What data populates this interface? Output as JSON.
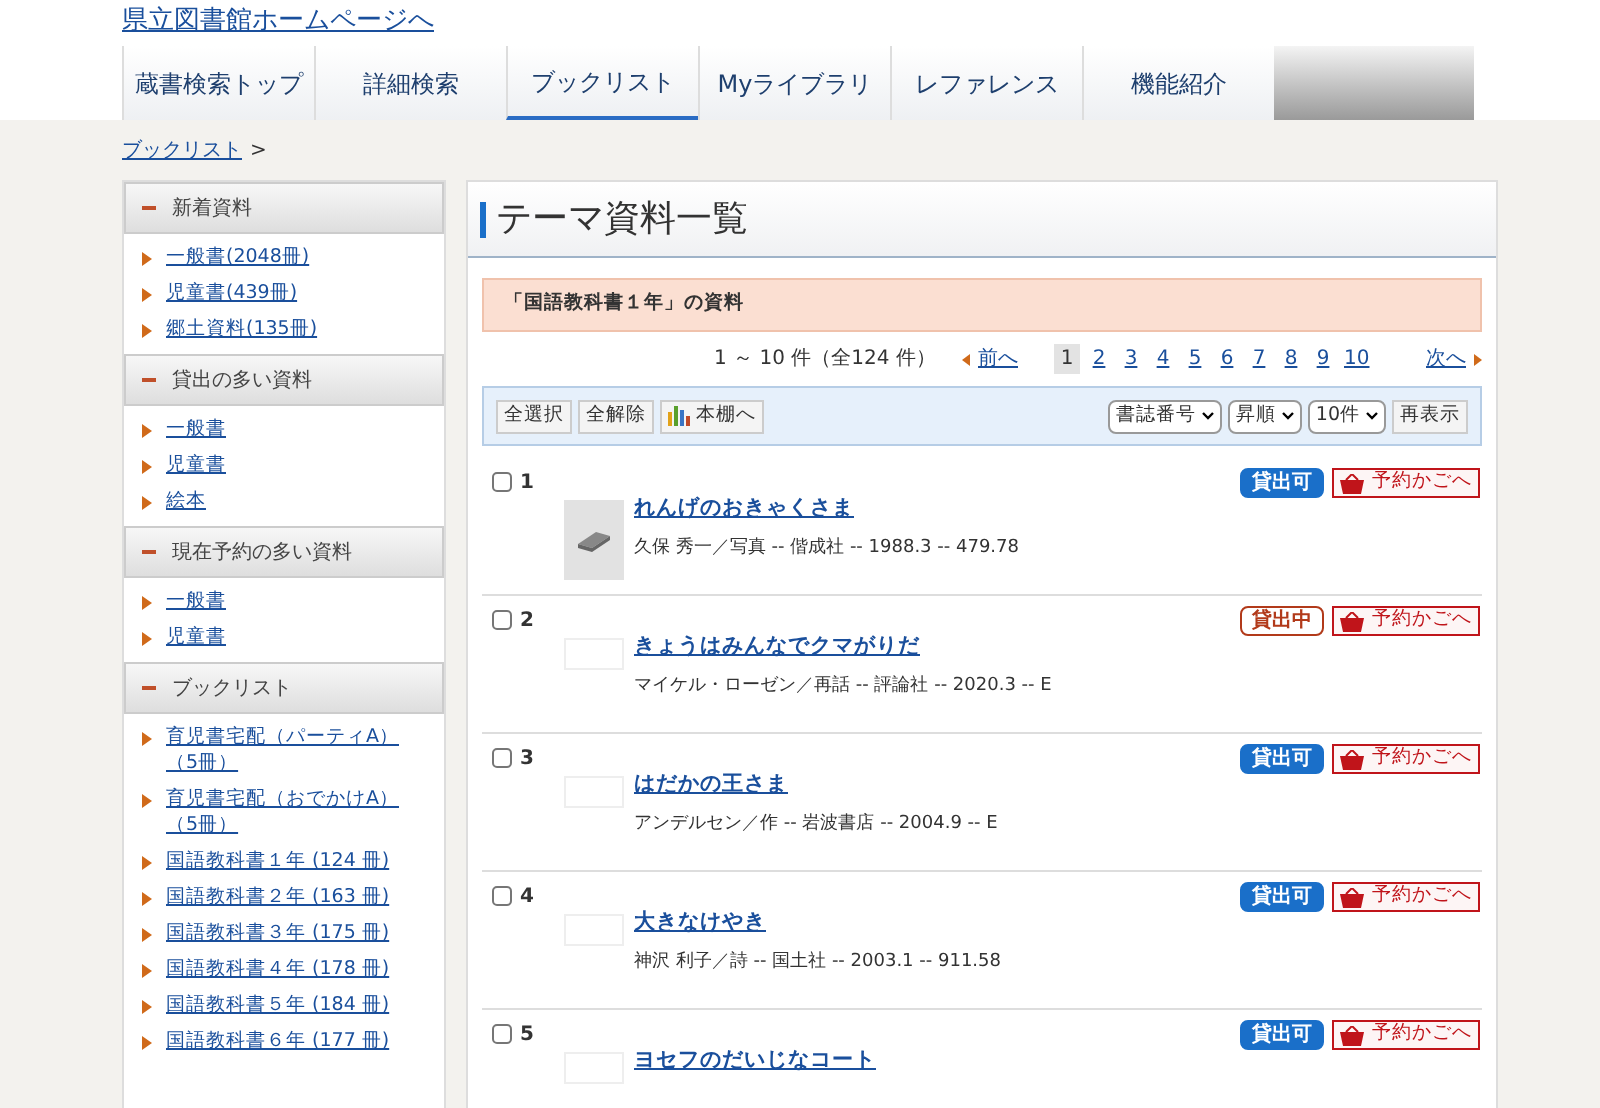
{
  "header": {
    "home_link": "県立図書館ホームページへ"
  },
  "tabs": [
    {
      "label": "蔵書検索トップ",
      "selected": false
    },
    {
      "label": "詳細検索",
      "selected": false
    },
    {
      "label": "ブックリスト",
      "selected": true
    },
    {
      "label": "Myライブラリ",
      "selected": false
    },
    {
      "label": "レファレンス",
      "selected": false
    },
    {
      "label": "機能紹介",
      "selected": false
    }
  ],
  "breadcrumb": {
    "link": "ブックリスト",
    "separator": ">"
  },
  "sidebar": {
    "sections": [
      {
        "title": "新着資料",
        "items": [
          "一般書(2048冊)",
          "児童書(439冊)",
          "郷土資料(135冊)"
        ]
      },
      {
        "title": "貸出の多い資料",
        "items": [
          "一般書",
          "児童書",
          "絵本"
        ]
      },
      {
        "title": "現在予約の多い資料",
        "items": [
          "一般書",
          "児童書"
        ]
      },
      {
        "title": "ブックリスト",
        "items": [
          "育児書宅配（パーティA）（5冊）",
          "育児書宅配（おでかけA）（5冊）",
          "国語教科書１年 (124 冊)",
          "国語教科書２年 (163 冊)",
          "国語教科書３年 (175 冊)",
          "国語教科書４年 (178 冊)",
          "国語教科書５年 (184 冊)",
          "国語教科書６年 (177 冊)"
        ]
      }
    ]
  },
  "main": {
    "title": "テーマ資料一覧",
    "notice": "「国語教科書１年」の資料",
    "pager": {
      "range": "1 ～ 10 件（全124 件）",
      "prev": "前へ",
      "next": "次へ",
      "pages": [
        {
          "label": "1",
          "selected": true
        },
        {
          "label": "2",
          "selected": false
        },
        {
          "label": "3",
          "selected": false
        },
        {
          "label": "4",
          "selected": false
        },
        {
          "label": "5",
          "selected": false
        },
        {
          "label": "6",
          "selected": false
        },
        {
          "label": "7",
          "selected": false
        },
        {
          "label": "8",
          "selected": false
        },
        {
          "label": "9",
          "selected": false
        },
        {
          "label": "10",
          "selected": false
        }
      ]
    },
    "toolbar": {
      "select_all": "全選択",
      "deselect_all": "全解除",
      "shelf": "本棚へ",
      "sort_field": "書誌番号",
      "sort_order": "昇順",
      "per_page": "10件",
      "refresh": "再表示"
    },
    "results": [
      {
        "number": "1",
        "checked": false,
        "has_cover": true,
        "title": "れんげのおきゃくさま",
        "meta": "久保 秀一／写真 -- 偕成社 -- 1988.3 -- 479.78",
        "status": {
          "label": "貸出可",
          "kind": "available"
        },
        "reserve": "予約かごへ"
      },
      {
        "number": "2",
        "checked": false,
        "has_cover": false,
        "title": "きょうはみんなでクマがりだ",
        "meta": "マイケル・ローゼン／再話 -- 評論社 -- 2020.3 -- E",
        "status": {
          "label": "貸出中",
          "kind": "on_loan"
        },
        "reserve": "予約かごへ"
      },
      {
        "number": "3",
        "checked": false,
        "has_cover": false,
        "title": "はだかの王さま",
        "meta": "アンデルセン／作 -- 岩波書店 -- 2004.9 -- E",
        "status": {
          "label": "貸出可",
          "kind": "available"
        },
        "reserve": "予約かごへ"
      },
      {
        "number": "4",
        "checked": false,
        "has_cover": false,
        "title": "大きなけやき",
        "meta": "神沢 利子／詩 -- 国土社 -- 2003.1 -- 911.58",
        "status": {
          "label": "貸出可",
          "kind": "available"
        },
        "reserve": "予約かごへ"
      },
      {
        "number": "5",
        "checked": false,
        "has_cover": false,
        "title": "ヨセフのだいじなコート",
        "status": {
          "label": "貸出可",
          "kind": "available"
        },
        "reserve": "予約かごへ"
      }
    ]
  }
}
